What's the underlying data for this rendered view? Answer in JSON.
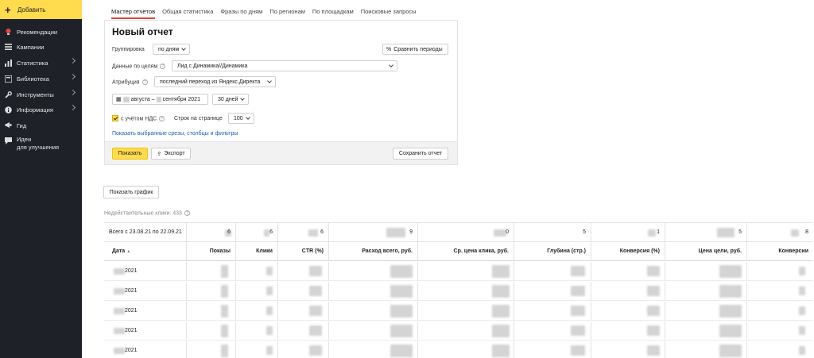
{
  "sidebar": {
    "add_label": "Добавить",
    "items": [
      {
        "label": "Рекомендации",
        "icon": "lightbulb-icon"
      },
      {
        "label": "Кампании",
        "icon": "list-icon"
      },
      {
        "label": "Статистика",
        "icon": "bar-chart-icon"
      },
      {
        "label": "Библиотека",
        "icon": "library-icon"
      },
      {
        "label": "Инструменты",
        "icon": "wrench-icon"
      },
      {
        "label": "Информация",
        "icon": "info-icon"
      },
      {
        "label": "Гид",
        "icon": "guide-icon"
      },
      {
        "label_line1": "Идеи",
        "label_line2": "для улучшения",
        "icon": "idea-icon"
      }
    ]
  },
  "tabs": [
    "Мастер отчётов",
    "Общая статистика",
    "Фразы по дням",
    "По регионам",
    "По площадкам",
    "Поисковые запросы"
  ],
  "panel": {
    "title": "Новый отчет",
    "grouping_label": "Группировка",
    "grouping_value": "по дням",
    "compare_label": "Сравнить периоды",
    "goals_label": "Данные по целям",
    "goals_value": "Лид с Динамика//Динамика",
    "attribution_label": "Атрибуция",
    "attribution_value": "последний переход из Яндекс.Директа",
    "date_from": "августа –",
    "date_to": "сентября 2021",
    "period_value": "30 дней",
    "vat_label": "с учётом НДС",
    "rows_label": "Строк на странице",
    "rows_value": "100",
    "link_text": "Показать выбранные срезы, столбцы и фильтры",
    "show_btn": "Показать",
    "export_btn": "Экспорт",
    "save_btn": "Сохранить отчет"
  },
  "show_chart_btn": "Показать график",
  "invalid_clicks": "Недействительные клики: 433",
  "table": {
    "totals_label": "Всего с 23.08.21 по 22.09.21",
    "totals_suffixes": [
      "6",
      "6",
      "6",
      "9",
      "0",
      "5",
      "1",
      "5",
      "8"
    ],
    "headers": [
      "Дата",
      "Показы",
      "Клики",
      "CTR (%)",
      "Расход всего, руб.",
      "Ср. цена клика, руб.",
      "Глубина (стр.)",
      "Конверсия (%)",
      "Цена цели, руб.",
      "Конверсии"
    ],
    "sort_mark": "▲",
    "rows": [
      "2021",
      "2021",
      "2021",
      "2021",
      "2021"
    ]
  },
  "colors": {
    "accent": "#ffdb4d",
    "sidebar": "#1e2127",
    "link": "#1a5fb4",
    "tab_active": "#e0443b"
  }
}
